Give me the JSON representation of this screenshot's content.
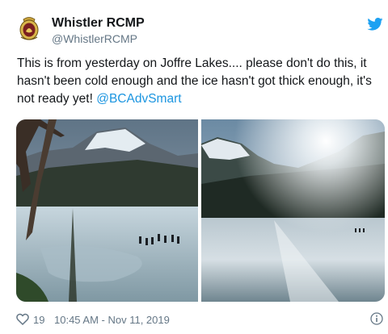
{
  "tweet": {
    "author_name": "Whistler RCMP",
    "author_handle": "@WhistlerRCMP",
    "text_main": "This is from yesterday on Joffre Lakes.... please don't do this, it hasn't been cold enough and the ice hasn't got thick enough, it's not ready yet! ",
    "mention": "@BCAdvSmart",
    "like_count": "19",
    "timestamp": "10:45 AM - Nov 11, 2019"
  },
  "colors": {
    "accent": "#1b95e0",
    "text": "#14171a",
    "muted": "#657786",
    "twitter_blue": "#1da1f2"
  },
  "icons": {
    "logo": "rcmp-crest-icon",
    "brand": "twitter-bird-icon",
    "like": "heart-icon",
    "info": "info-icon"
  }
}
